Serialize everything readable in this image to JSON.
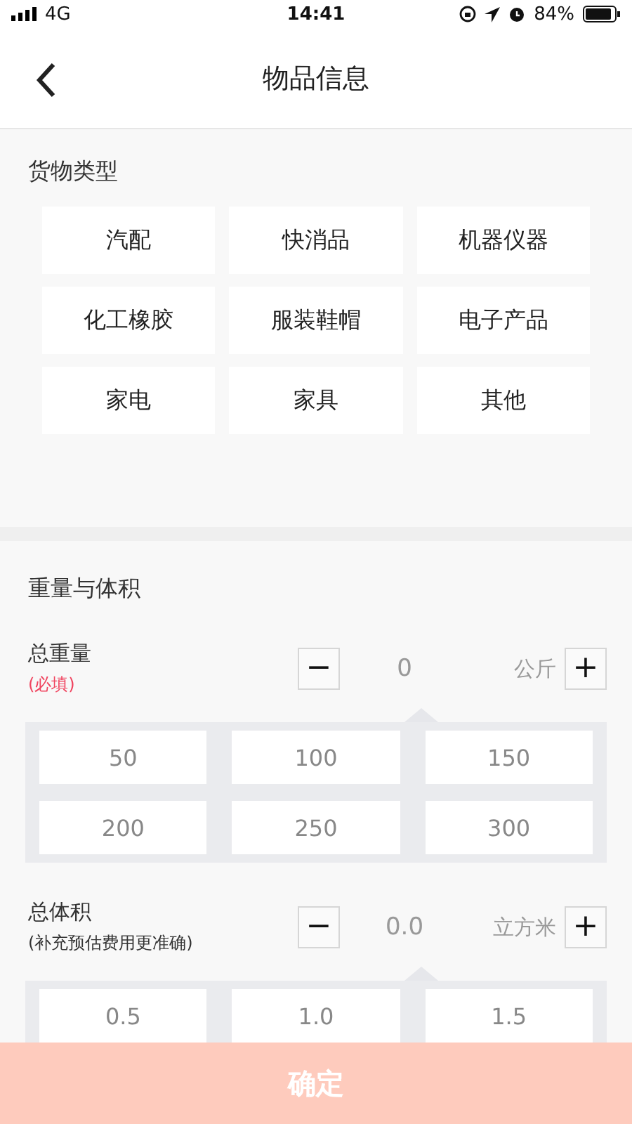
{
  "status_bar": {
    "carrier": "4G",
    "time": "14:41",
    "battery": "84%"
  },
  "nav": {
    "title": "物品信息"
  },
  "cargo_types": {
    "title": "货物类型",
    "items": [
      "汽配",
      "快消品",
      "机器仪器",
      "化工橡胶",
      "服装鞋帽",
      "电子产品",
      "家电",
      "家具",
      "其他"
    ]
  },
  "size_section": {
    "title": "重量与体积",
    "fields": [
      {
        "label": "总重量",
        "note": "(必填)",
        "required": true,
        "minus": "−",
        "value": "0",
        "unit": "公斤",
        "plus": "+",
        "presets": [
          "50",
          "100",
          "150",
          "200",
          "250",
          "300"
        ]
      },
      {
        "label": "总体积",
        "note": "(补充预估费用更准确)",
        "required": false,
        "minus": "−",
        "value": "0.0",
        "unit": "立方米",
        "plus": "+",
        "presets": [
          "0.5",
          "1.0",
          "1.5"
        ]
      }
    ]
  },
  "confirm": {
    "label": "确定",
    "disabled": true
  }
}
